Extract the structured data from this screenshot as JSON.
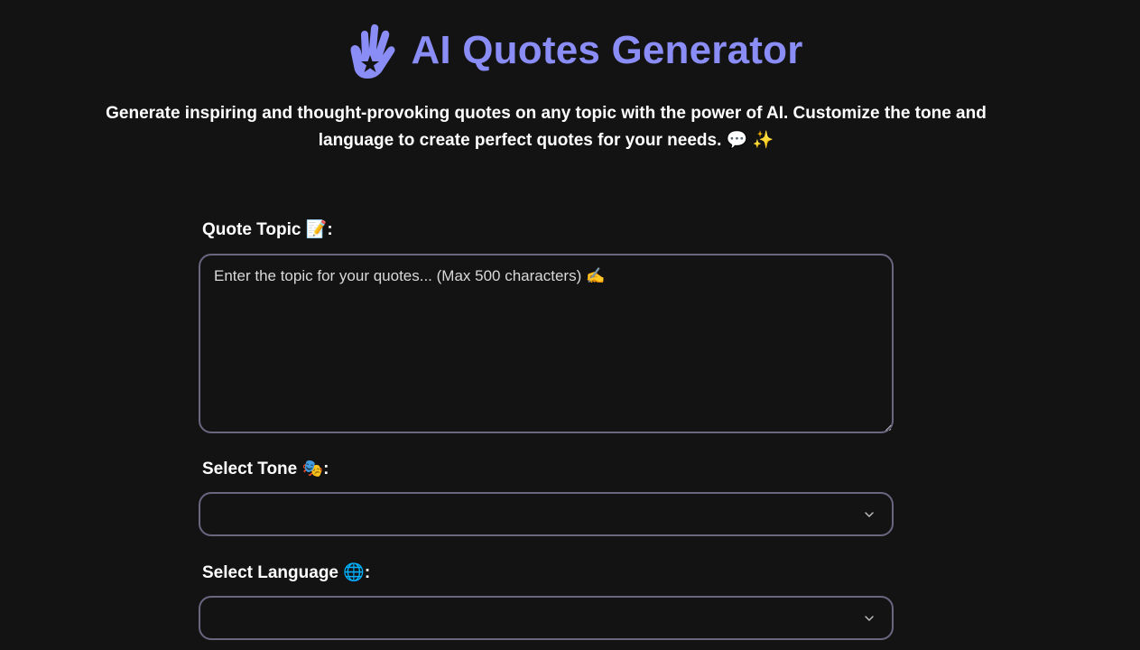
{
  "header": {
    "logo_icon": "hand-star-icon",
    "title": "AI Quotes Generator",
    "accent_color": "#8b8df6"
  },
  "intro": {
    "description": "Generate inspiring and thought-provoking quotes on any topic with the power of AI. Customize the tone and language to create perfect quotes for your needs. 💬 ✨"
  },
  "form": {
    "topic": {
      "label": "Quote Topic 📝:",
      "placeholder": "Enter the topic for your quotes... (Max 500 characters) ✍️",
      "value": ""
    },
    "tone": {
      "label": "Select Tone 🎭:",
      "selected": ""
    },
    "language": {
      "label": "Select Language 🌐:",
      "selected": ""
    }
  },
  "colors": {
    "background": "#131314",
    "border": "#6b6580",
    "text": "#ffffff"
  }
}
